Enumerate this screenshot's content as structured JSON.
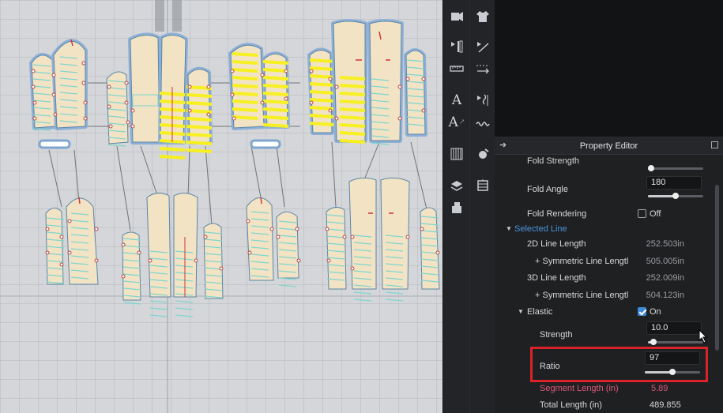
{
  "property_editor": {
    "title": "Property Editor",
    "fold_strength": {
      "label": "Fold Strength",
      "slider_fraction": 0.05
    },
    "fold_angle": {
      "label": "Fold Angle",
      "value": "180",
      "slider_fraction": 0.5
    },
    "fold_rendering": {
      "label": "Fold Rendering",
      "checked": false,
      "state_label": "Off"
    },
    "selected_line": {
      "section_label": "Selected Line",
      "line_length_2d": {
        "label": "2D Line Length",
        "value": "252.503in"
      },
      "symmetric_2d": {
        "label": "+ Symmetric Line Lengtl",
        "value": "505.005in"
      },
      "line_length_3d": {
        "label": "3D Line Length",
        "value": "252.009in"
      },
      "symmetric_3d": {
        "label": "+ Symmetric Line Lengtl",
        "value": "504.123in"
      },
      "elastic": {
        "label": "Elastic",
        "checked": true,
        "state_label": "On",
        "strength": {
          "label": "Strength",
          "value": "10.0",
          "slider_fraction": 0.1
        },
        "ratio": {
          "label": "Ratio",
          "value": "97",
          "slider_fraction": 0.5
        }
      },
      "segment_length": {
        "label": "Segment Length (in)",
        "value": "5.89"
      },
      "total_length": {
        "label": "Total Length (in)",
        "value": "489.855"
      }
    }
  },
  "toolbar": {
    "left": [
      "avatar-toggle-icon",
      "line-length-icon",
      "ruler-icon",
      "text-add-icon",
      "text-edit-icon",
      "grid-icon",
      "fabric-icon",
      "pattern-stack-icon"
    ],
    "right": [
      "garment-icon",
      "edit-line-icon",
      "segment-measure-icon",
      "elastic-line-icon",
      "stitch-icon",
      "tape-icon",
      "model-icon"
    ]
  },
  "colors": {
    "accent": "#3f8bd6",
    "segment_label": "#e0577a",
    "highlight": "#d9232a",
    "pattern_fill": "#f2e3c4",
    "selected_elastic": "#f7f021",
    "elastic_line": "#7fd6cf"
  }
}
